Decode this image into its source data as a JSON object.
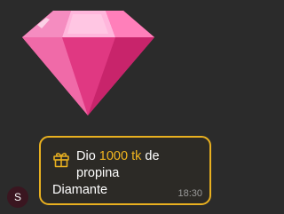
{
  "gem": {
    "icon": "pink-diamond-icon",
    "color": "#e8458f"
  },
  "avatar": {
    "initial": "S"
  },
  "message": {
    "gift_icon": "gift-icon",
    "prefix": "Dio",
    "amount": "1000 tk",
    "line_rest": "de",
    "line2": "propina",
    "line3": "Diamante",
    "time": "18:30",
    "accent_color": "#e8b020"
  }
}
